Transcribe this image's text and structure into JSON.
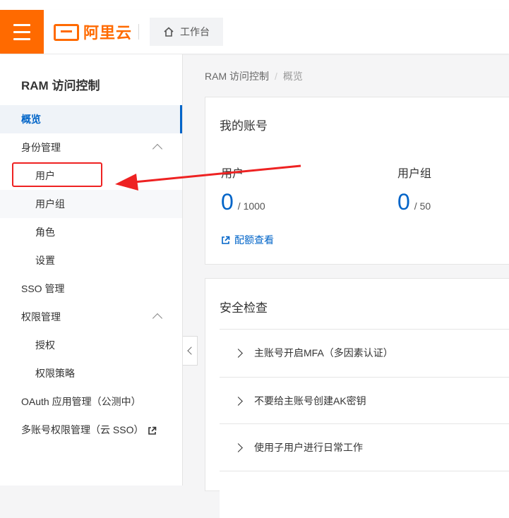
{
  "header": {
    "brand": "阿里云",
    "workbench_label": "工作台"
  },
  "sidebar": {
    "title": "RAM 访问控制",
    "items": [
      {
        "label": "概览"
      },
      {
        "label": "身份管理"
      },
      {
        "label": "用户"
      },
      {
        "label": "用户组"
      },
      {
        "label": "角色"
      },
      {
        "label": "设置"
      },
      {
        "label": "SSO 管理"
      },
      {
        "label": "权限管理"
      },
      {
        "label": "授权"
      },
      {
        "label": "权限策略"
      },
      {
        "label": "OAuth 应用管理（公测中）"
      },
      {
        "label": "多账号权限管理（云 SSO）"
      }
    ]
  },
  "breadcrumb": {
    "root": "RAM 访问控制",
    "separator": "/",
    "current": "概览"
  },
  "account_card": {
    "title": "我的账号",
    "users_label": "用户",
    "users_count": "0",
    "users_total": "/ 1000",
    "groups_label": "用户组",
    "groups_count": "0",
    "groups_total": "/ 50",
    "quota_link": "配额查看"
  },
  "security_card": {
    "title": "安全检查",
    "items": [
      {
        "label": "主账号开启MFA（多因素认证）"
      },
      {
        "label": "不要给主账号创建AK密钥"
      },
      {
        "label": "使用子用户进行日常工作"
      }
    ]
  },
  "colors": {
    "brand": "#ff6a00",
    "accent": "#0064c8",
    "annotation": "#ee2222"
  }
}
